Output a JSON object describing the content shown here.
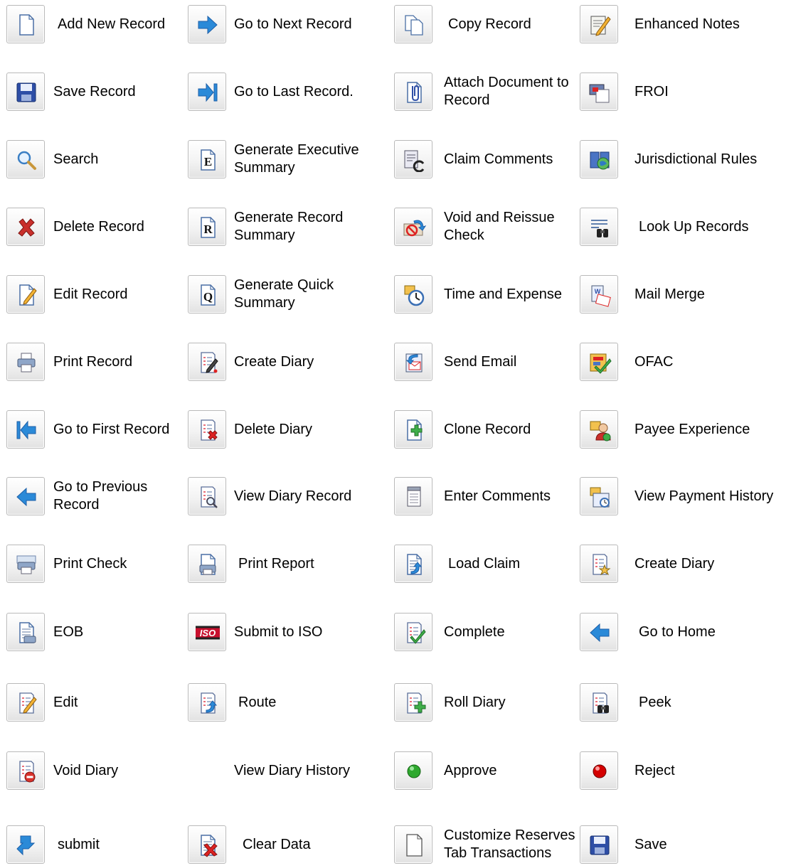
{
  "legend": [
    [
      {
        "icon": "new-document-icon",
        "label": "Add New Record"
      },
      {
        "icon": "save-disk-icon",
        "label": "Save Record"
      },
      {
        "icon": "magnifier-icon",
        "label": "Search"
      },
      {
        "icon": "red-x-icon",
        "label": "Delete Record"
      },
      {
        "icon": "edit-pencil-icon",
        "label": "Edit Record"
      },
      {
        "icon": "printer-icon",
        "label": "Print Record"
      },
      {
        "icon": "first-record-arrow-icon",
        "label": "Go to First Record"
      },
      {
        "icon": "left-arrow-icon",
        "label": "Go to Previous Record"
      },
      {
        "icon": "print-check-icon",
        "label": "Print Check"
      },
      {
        "icon": "eob-printer-icon",
        "label": "EOB"
      },
      {
        "icon": "diary-edit-pencil-icon",
        "label": "Edit"
      },
      {
        "icon": "void-diary-icon",
        "label": "Void Diary"
      },
      {
        "icon": "submit-arrow-icon",
        "label": "submit"
      }
    ],
    [
      {
        "icon": "right-arrow-icon",
        "label": "Go to Next Record"
      },
      {
        "icon": "last-record-arrow-icon",
        "label": "Go to Last Record."
      },
      {
        "icon": "letter-e-icon",
        "label": "Generate Executive Summary"
      },
      {
        "icon": "letter-r-icon",
        "label": "Generate Record Summary"
      },
      {
        "icon": "letter-q-icon",
        "label": "Generate Quick Summary"
      },
      {
        "icon": "create-diary-icon",
        "label": "Create Diary"
      },
      {
        "icon": "delete-diary-icon",
        "label": "Delete Diary"
      },
      {
        "icon": "view-diary-magnifier-icon",
        "label": "View Diary Record"
      },
      {
        "icon": "print-report-icon",
        "label": "Print Report"
      },
      {
        "icon": "iso-badge-icon",
        "label": "Submit to ISO"
      },
      {
        "icon": "route-diary-icon",
        "label": "Route"
      },
      {
        "icon": "",
        "label": "View Diary History"
      },
      {
        "icon": "clear-data-icon",
        "label": "Clear Data"
      }
    ],
    [
      {
        "icon": "copy-documents-icon",
        "label": "Copy Record"
      },
      {
        "icon": "paperclip-icon",
        "label": "Attach Document to Record"
      },
      {
        "icon": "claim-comments-icon",
        "label": "Claim Comments"
      },
      {
        "icon": "void-reissue-check-icon",
        "label": "Void and Reissue Check"
      },
      {
        "icon": "time-expense-clock-icon",
        "label": "Time and Expense"
      },
      {
        "icon": "send-email-icon",
        "label": "Send Email"
      },
      {
        "icon": "clone-plus-icon",
        "label": "Clone Record"
      },
      {
        "icon": "notepad-icon",
        "label": "Enter Comments"
      },
      {
        "icon": "load-claim-icon",
        "label": "Load Claim"
      },
      {
        "icon": "complete-check-icon",
        "label": "Complete"
      },
      {
        "icon": "roll-diary-icon",
        "label": "Roll Diary"
      },
      {
        "icon": "green-dot-icon",
        "label": "Approve"
      },
      {
        "icon": "blank-page-icon",
        "label": "Customize Reserves Tab Transactions"
      }
    ],
    [
      {
        "icon": "enhanced-notes-icon",
        "label": "Enhanced Notes"
      },
      {
        "icon": "froi-icon",
        "label": "FROI"
      },
      {
        "icon": "globe-book-icon",
        "label": "Jurisdictional Rules"
      },
      {
        "icon": "binoculars-list-icon",
        "label": "Look Up Records"
      },
      {
        "icon": "mail-merge-icon",
        "label": "Mail Merge"
      },
      {
        "icon": "ofac-check-icon",
        "label": "OFAC"
      },
      {
        "icon": "payee-person-icon",
        "label": "Payee Experience"
      },
      {
        "icon": "payment-history-icon",
        "label": "View Payment History"
      },
      {
        "icon": "create-diary-star-icon",
        "label": "Create Diary"
      },
      {
        "icon": "home-arrow-icon",
        "label": "Go to Home"
      },
      {
        "icon": "peek-binoculars-icon",
        "label": "Peek"
      },
      {
        "icon": "red-dot-icon",
        "label": "Reject"
      },
      {
        "icon": "save-disk-icon",
        "label": "Save"
      }
    ]
  ],
  "iso_text": "ISO",
  "letter_e": "E",
  "letter_r": "R",
  "letter_q": "Q",
  "colors": {
    "accent_blue": "#2b8ad8",
    "button_border": "#b9b9b9",
    "approve_green": "#2ea82e",
    "reject_red": "#d40000"
  }
}
